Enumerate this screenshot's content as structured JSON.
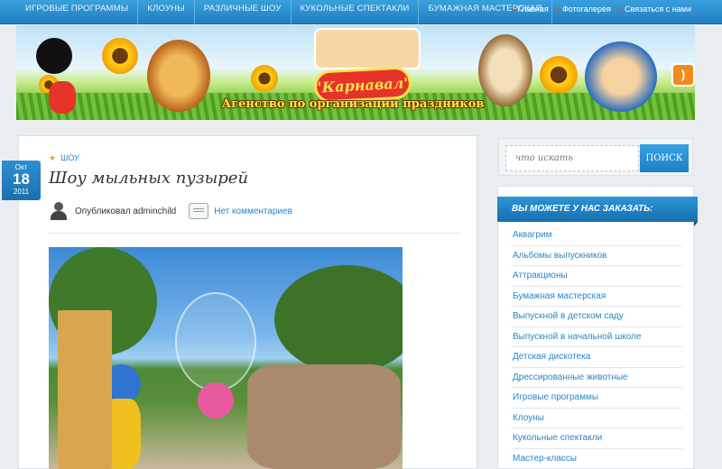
{
  "topnav": {
    "menu": [
      "ИГРОВЫЕ ПРОГРАММЫ",
      "КЛОУНЫ",
      "РАЗЛИЧНЫЕ ШОУ",
      "КУКОЛЬНЫЕ СПЕКТАКЛИ",
      "БУМАЖНАЯ МАСТЕРСКАЯ"
    ],
    "right": [
      "Главная",
      "Фотогалерея",
      "Связаться с нами"
    ]
  },
  "banner": {
    "title": "\"Карнавал\"",
    "subtitle": "Агенство по организации праздников",
    "rss_icon": "rss-icon"
  },
  "post": {
    "category": "ШОУ",
    "title": "Шоу мыльных пузырей",
    "date": {
      "month": "Окт",
      "day": "18",
      "year": "2011"
    },
    "author": "Опубликовал adminchild",
    "comments": "Нет комментариев"
  },
  "sidebar": {
    "search_placeholder": "что искать",
    "search_button": "ПОИСК",
    "widget_title": "ВЫ МОЖЕТЕ У НАС ЗАКАЗАТЬ:",
    "items": [
      "Аквагрим",
      "Альбомы выпускников",
      "Аттракционы",
      "Бумажная мастерская",
      "Выпускной в детском саду",
      "Выпускной в начальной школе",
      "Детская дискотека",
      "Дрессированные животные",
      "Игровые программы",
      "Клоуны",
      "Кукольные спектакли",
      "Мастер-классы"
    ]
  },
  "colors": {
    "accent": "#2a86c6",
    "nav": "#1f7fc0",
    "title_red": "#e6332a"
  }
}
